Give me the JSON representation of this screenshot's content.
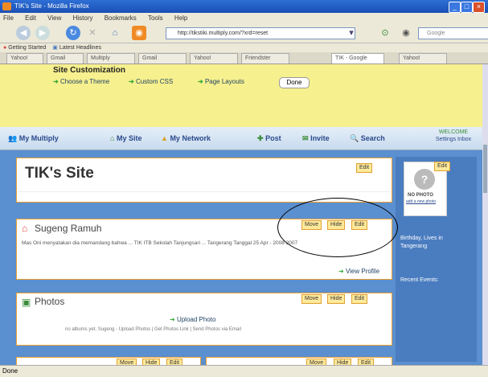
{
  "window": {
    "title": "TIK's Site - Mozilla Firefox"
  },
  "menu": [
    "File",
    "Edit",
    "View",
    "History",
    "Bookmarks",
    "Tools",
    "Help"
  ],
  "toolbar": {
    "url": "http://tikstiki.multiply.com/?xrd=reset",
    "search_placeholder": "Google"
  },
  "bookmarks": [
    "Getting Started",
    "Latest Headlines"
  ],
  "tabs": [
    "Yahoo!",
    "Gmail",
    "Multiply",
    "Gmail",
    "Yahoo!",
    "Friendster",
    "TIK - Google",
    "Yahoo!"
  ],
  "customization": {
    "title": "Site Customization",
    "links": [
      "Choose a Theme",
      "Custom CSS",
      "Page Layouts"
    ],
    "done": "Done"
  },
  "sitenav": {
    "my_multiply": "My Multiply",
    "my_site": "My Site",
    "my_network": "My Network",
    "post": "Post",
    "invite": "Invite",
    "search": "Search",
    "user": "WELCOME",
    "user_sub": "Settings  Inbox"
  },
  "panels": {
    "site_title": "TIK's Site",
    "edit": "Edit",
    "move": "Move",
    "hide": "Hide",
    "profile": {
      "name": "Sugeng Ramuh",
      "text": "Mas Oni menyatakan dia memandang bahwa ... TIK ITB Sekolah Tanjungsari ... Tangerang Tanggal 25 Apr - 2008 2007",
      "view_profile": "View Profile"
    },
    "photos": {
      "title": "Photos",
      "upload": "Upload Photo",
      "hint": "no albums yet. Sugeng - Upload Photos | Get Photos Link | Send Photos via Email"
    }
  },
  "sidebar": {
    "no_photo": "NO PHOTO",
    "add_photo": "add a new photo",
    "edit": "Edit",
    "line1": "Birthday, Lives in",
    "line2": "Tangerang",
    "recent": "Recent Events:"
  },
  "status": "Done"
}
